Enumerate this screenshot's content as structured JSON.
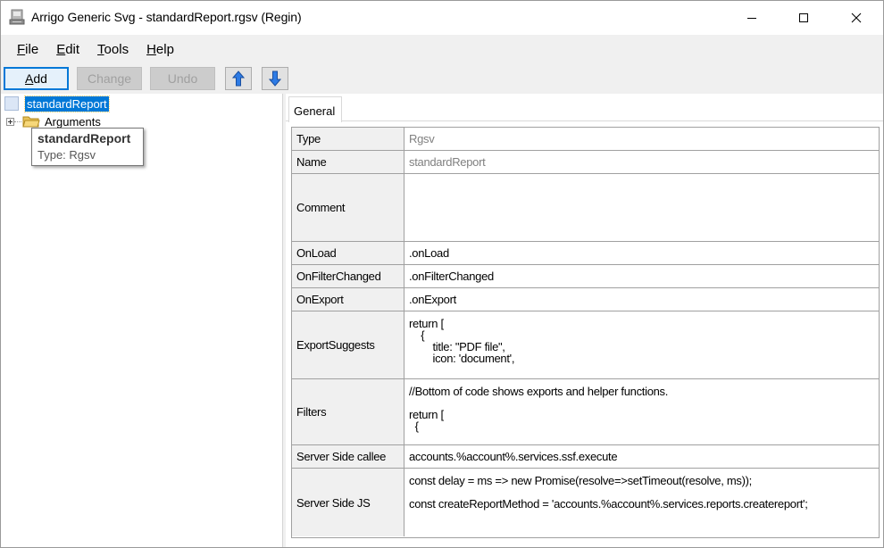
{
  "window": {
    "title": "Arrigo Generic Svg - standardReport.rgsv (Regin)",
    "icon": "app-document-icon"
  },
  "menu": {
    "items": [
      {
        "u": "F",
        "rest": "ile"
      },
      {
        "u": "E",
        "rest": "dit"
      },
      {
        "u": "T",
        "rest": "ools"
      },
      {
        "u": "H",
        "rest": "elp"
      }
    ]
  },
  "toolbar": {
    "add_u": "A",
    "add_rest": "dd",
    "change_label": "Change",
    "undo_label": "Undo",
    "up_icon": "arrow-up-icon",
    "down_icon": "arrow-down-icon"
  },
  "tree": {
    "root_label": "standardReport",
    "child_label": "Arguments"
  },
  "tooltip": {
    "title": "standardReport",
    "subtitle": "Type: Rgsv"
  },
  "tabs": [
    {
      "label": "General"
    }
  ],
  "properties": [
    {
      "label": "Type",
      "value": "Rgsv"
    },
    {
      "label": "Name",
      "value": "standardReport"
    },
    {
      "label": "Comment",
      "value": ""
    },
    {
      "label": "OnLoad",
      "value": ".onLoad"
    },
    {
      "label": "OnFilterChanged",
      "value": ".onFilterChanged"
    },
    {
      "label": "OnExport",
      "value": ".onExport"
    },
    {
      "label": "ExportSuggests",
      "value": "return [\n    {\n        title: \"PDF file\",\n        icon: 'document',"
    },
    {
      "label": "Filters",
      "value": "//Bottom of code shows exports and helper functions.\n\nreturn [\n  {"
    },
    {
      "label": "Server Side callee",
      "value": "accounts.%account%.services.ssf.execute"
    },
    {
      "label": "Server Side JS",
      "value": "const delay = ms => new Promise(resolve=>setTimeout(resolve, ms));\n\nconst createReportMethod = 'accounts.%account%.services.reports.createreport';"
    }
  ],
  "colors": {
    "selection": "#0078d7",
    "label_bg": "#f0f0f0",
    "grid_line": "#a0a0a0"
  }
}
